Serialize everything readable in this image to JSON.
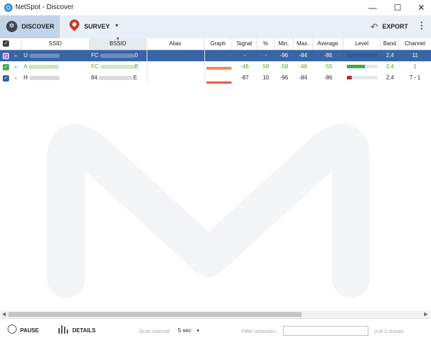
{
  "window": {
    "title": "NetSpot - Discover",
    "minimize_glyph": "—",
    "maximize_glyph": "☐",
    "close_glyph": "✕"
  },
  "toolbar": {
    "discover_label": "DISCOVER",
    "survey_label": "SURVEY",
    "export_label": "EXPORT",
    "icons": [
      "discover-icon",
      "survey-pin-icon",
      "export-icon",
      "more-vert-icon"
    ]
  },
  "table": {
    "columns": [
      "SSID",
      "BSSID",
      "Alias",
      "Graph",
      "Signal",
      "%",
      "Min.",
      "Max.",
      "Average",
      "Level",
      "Band",
      "Channel"
    ],
    "sorted_column": "BSSID",
    "rows": [
      {
        "ssid": "U",
        "bssid": "FC",
        "bssid_end": "0",
        "alias": "",
        "signal": "-",
        "percent": "-",
        "min": "-96",
        "max": "-84",
        "average": "-86",
        "level": 0.0,
        "band": "2,4",
        "channel": "11",
        "selected": true,
        "checkbox_color": "#b57ad6",
        "text_color": "#ffffff"
      },
      {
        "ssid": "A",
        "bssid": "FC",
        "bssid_end": "B",
        "alias": "",
        "signal": "-46",
        "percent": "58",
        "min": "-58",
        "max": "-46",
        "average": "-55",
        "level": 0.58,
        "band": "2,4",
        "channel": "1",
        "selected": false,
        "checkbox_color": "#3faa48",
        "text_color": "#5c9c1f"
      },
      {
        "ssid": "H",
        "bssid": "84",
        "bssid_end": "E",
        "alias": "",
        "signal": "-87",
        "percent": "10",
        "min": "-96",
        "max": "-84",
        "average": "-86",
        "level": 0.15,
        "band": "2,4",
        "channel": "7 - 1",
        "selected": false,
        "checkbox_color": "#2a5fa8",
        "text_color": "#222222"
      }
    ]
  },
  "statusbar": {
    "pause_label": "PAUSE",
    "details_label": "DETAILS",
    "scan_interval_label": "Scan interval:",
    "scan_interval_value": "5 sec",
    "filter_label": "Filter networks:",
    "filter_value": "",
    "shown_count": "3 of 3 shown"
  },
  "colors": {
    "accent": "#3a64a8",
    "toolbar_bg": "#e9eff6",
    "discover_active": "#c2d4e8",
    "green": "#3faa48",
    "red": "#c0282d"
  }
}
